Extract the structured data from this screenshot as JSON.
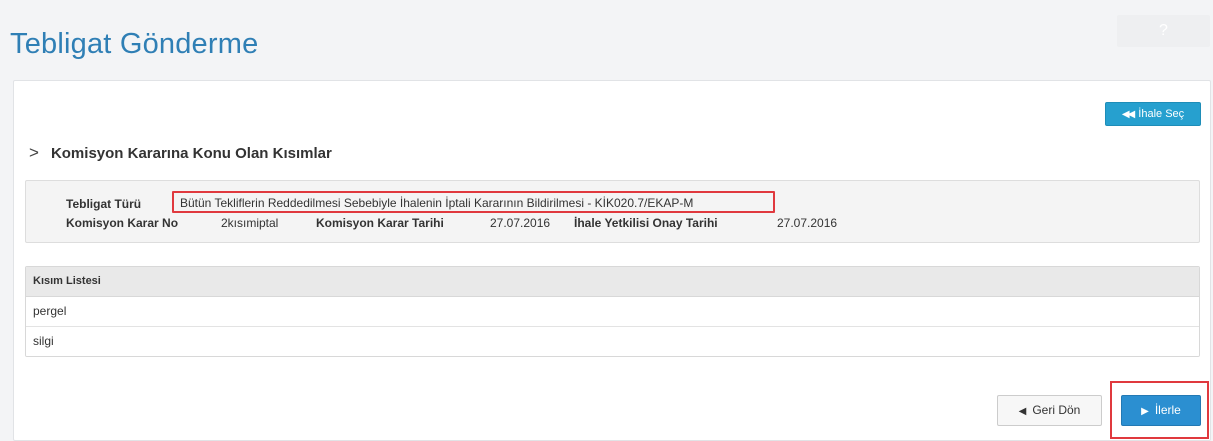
{
  "header": {
    "title": "Tebligat Gönderme",
    "help_label": "?"
  },
  "toolbar": {
    "ihale_sec_label": "İhale Seç"
  },
  "section": {
    "title": "Komisyon Kararına Konu Olan Kısımlar"
  },
  "info": {
    "tebligat_turu_label": "Tebligat Türü",
    "tebligat_turu_value": "Bütün Tekliflerin Reddedilmesi Sebebiyle İhalenin İptali Kararının Bildirilmesi - KİK020.7/EKAP-M",
    "karar_no_label": "Komisyon Karar No",
    "karar_no_value": "2kısımiptal",
    "karar_tarihi_label": "Komisyon Karar Tarihi",
    "karar_tarihi_value": "27.07.2016",
    "onay_tarihi_label": "İhale Yetkilisi Onay Tarihi",
    "onay_tarihi_value": "27.07.2016"
  },
  "kisim_listesi": {
    "header": "Kısım Listesi",
    "rows": [
      "pergel",
      "silgi"
    ]
  },
  "footer": {
    "geri_label": "Geri Dön",
    "ileri_label": "İlerle"
  },
  "colors": {
    "title": "#2f7fb5",
    "primary_button": "#2b8fd1",
    "info_button": "#26a0cf",
    "highlight": "#e0393e"
  }
}
